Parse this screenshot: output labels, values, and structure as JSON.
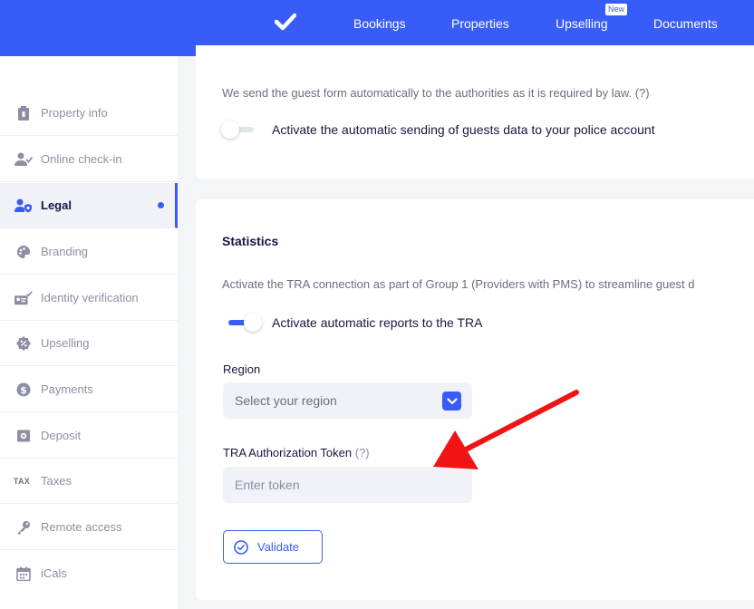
{
  "topbar": {
    "nav": [
      "Bookings",
      "Properties",
      "Upselling",
      "Documents"
    ],
    "new_badge": "New",
    "brand_color": "#385cf8"
  },
  "sidebar": {
    "items": [
      {
        "label": "Property info",
        "icon": "building-icon"
      },
      {
        "label": "Online check-in",
        "icon": "user-check-icon"
      },
      {
        "label": "Legal",
        "icon": "user-shield-icon",
        "active": true
      },
      {
        "label": "Branding",
        "icon": "palette-icon"
      },
      {
        "label": "Identity verification",
        "icon": "id-card-icon"
      },
      {
        "label": "Upselling",
        "icon": "percent-badge-icon"
      },
      {
        "label": "Payments",
        "icon": "dollar-icon"
      },
      {
        "label": "Deposit",
        "icon": "safe-icon"
      },
      {
        "label": "Taxes",
        "icon": "tax-icon",
        "icon_text": "TAX"
      },
      {
        "label": "Remote access",
        "icon": "key-icon"
      },
      {
        "label": "iCals",
        "icon": "calendar-icon"
      }
    ]
  },
  "police_section": {
    "description": "We send the guest form automatically to the authorities as it is required by law. (?)",
    "toggle_label": "Activate the automatic sending of guests data to your police account",
    "toggle_on": false
  },
  "statistics": {
    "title": "Statistics",
    "description": "Activate the TRA connection as part of Group 1 (Providers with PMS) to streamline guest d",
    "toggle_label": "Activate automatic reports to the TRA",
    "toggle_on": true,
    "region_label": "Region",
    "region_placeholder": "Select your region",
    "token_label": "TRA Authorization Token",
    "token_help": "(?)",
    "token_placeholder": "Enter token",
    "validate_label": "Validate"
  },
  "annotation": {
    "arrow_color": "#f01414"
  }
}
